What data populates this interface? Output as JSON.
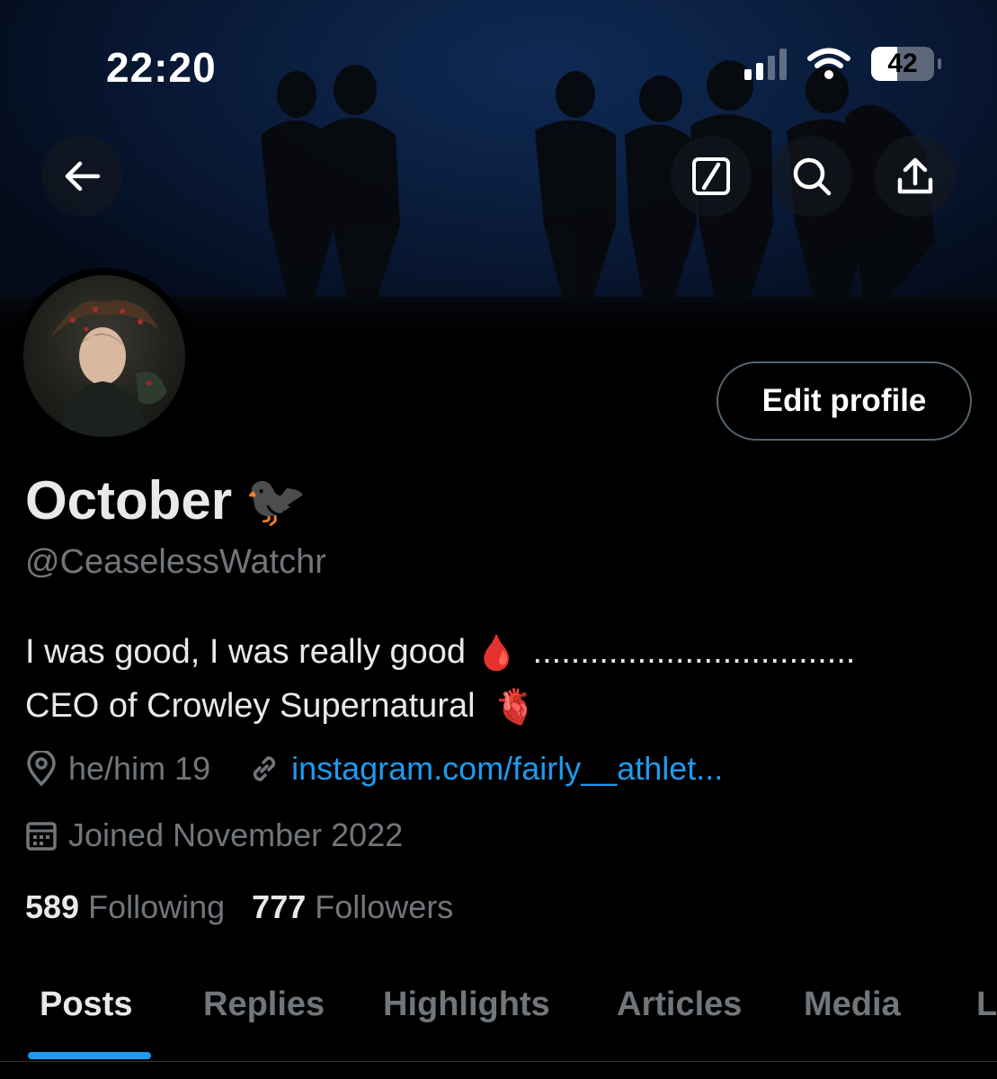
{
  "status_bar": {
    "time": "22:20",
    "battery_level": "42",
    "battery_fraction": 0.42,
    "signal_bars_active": 2
  },
  "header": {
    "back_icon": "back-arrow-icon",
    "icons": [
      "grok-icon",
      "search-icon",
      "share-icon"
    ]
  },
  "profile": {
    "edit_button": "Edit profile",
    "display_name": "October",
    "name_emoji": "🐦‍⬛",
    "handle": "@CeaselessWatchr",
    "bio_line1": "I was good, I was really good",
    "bio_emoji1": "🩸",
    "bio_dots": "..................................",
    "bio_line2": "CEO of Crowley Supernatural",
    "bio_emoji2": "🫀",
    "location": "he/him 19",
    "website": "instagram.com/fairly__athlet...",
    "joined": "Joined November 2022",
    "following_count": "589",
    "following_label": "Following",
    "followers_count": "777",
    "followers_label": "Followers"
  },
  "tabs": [
    "Posts",
    "Replies",
    "Highlights",
    "Articles",
    "Media",
    "L"
  ],
  "colors": {
    "accent": "#1d9bf0",
    "muted": "#71767b",
    "text": "#e7e9ea",
    "background": "#000000"
  }
}
